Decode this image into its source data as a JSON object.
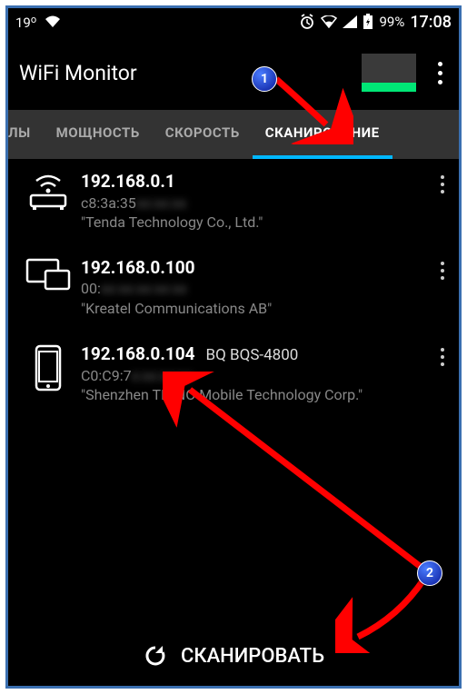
{
  "status": {
    "temp": "19",
    "degree": "o",
    "battery_pct": "99%",
    "clock": "17:08"
  },
  "app": {
    "title": "WiFi Monitor"
  },
  "tabs": {
    "partial": "ЛЫ",
    "t1": "МОЩНОСТЬ",
    "t2": "СКОРОСТЬ",
    "t3": "СКАНИРОВАНИЕ"
  },
  "devices": [
    {
      "ip": "192.168.0.1",
      "mac_visible": "c8:3a:35",
      "mac_hidden": "xx:xx:xx",
      "vendor": "\"Tenda Technology Co., Ltd.\"",
      "icon": "router"
    },
    {
      "ip": "192.168.0.100",
      "mac_visible": "00:",
      "mac_hidden": "xx:xx:xx:xx:xx",
      "vendor": "\"Kreatel Communications AB\"",
      "icon": "desktop"
    },
    {
      "ip": "192.168.0.104",
      "model": "BQ BQS-4800",
      "mac_visible": "C0:C9:7",
      "mac_hidden": "x:xx:xx:xx",
      "vendor": "\"Shenzhen TINNO Mobile Technology Corp.\"",
      "icon": "phone"
    }
  ],
  "scan_button": "СКАНИРОВАТЬ",
  "annotations": {
    "one": "1",
    "two": "2"
  }
}
